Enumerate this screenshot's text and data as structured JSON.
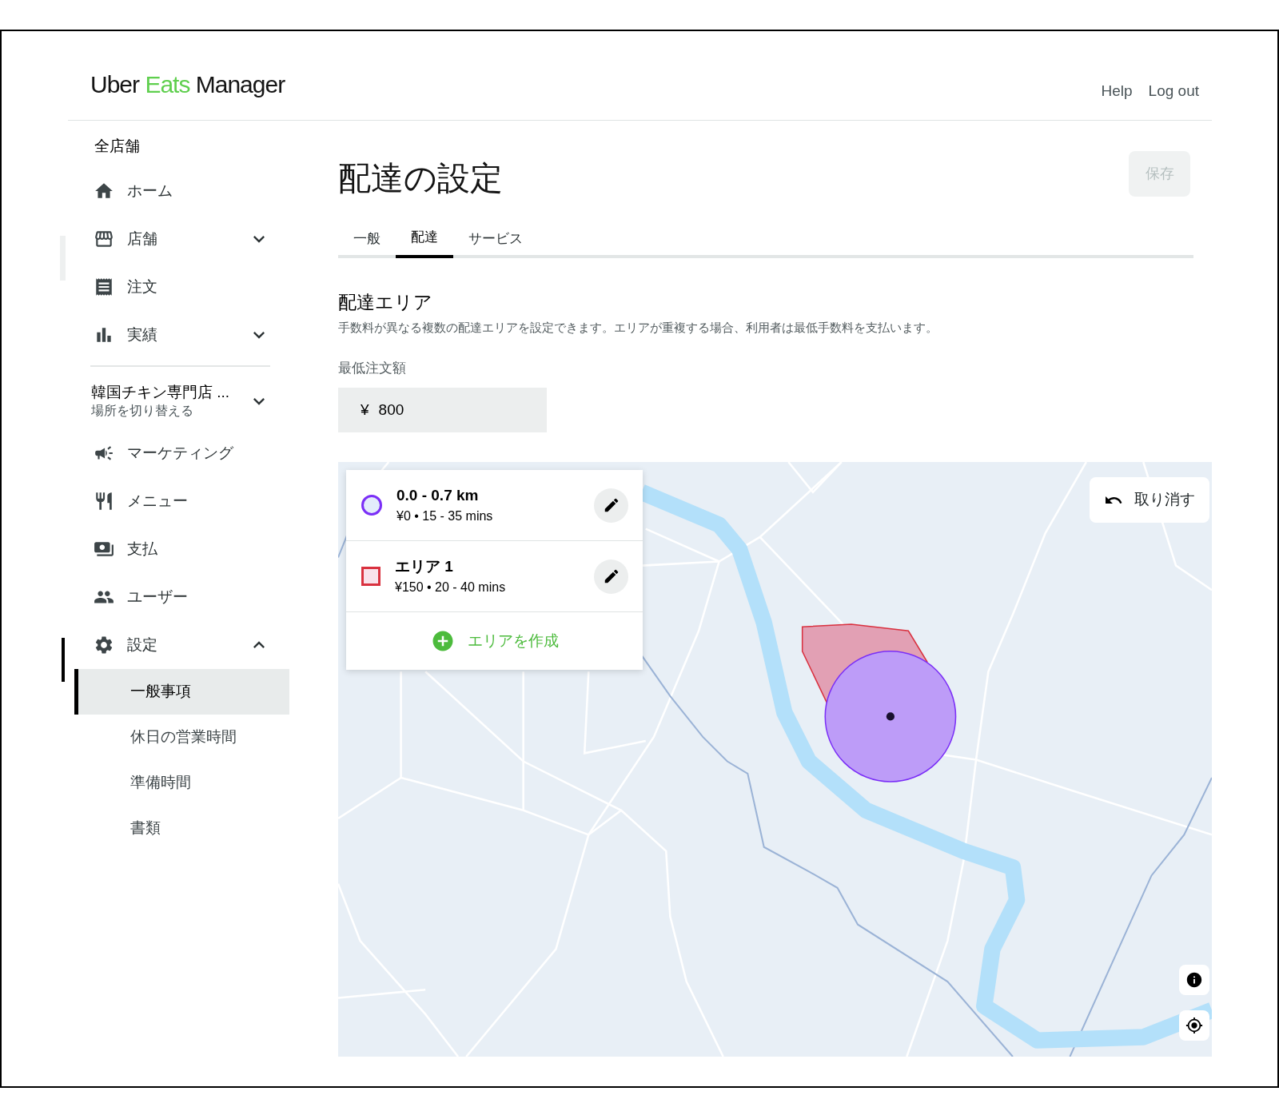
{
  "header": {
    "logo": {
      "brand": "Uber",
      "highlight": "Eats",
      "product": "Manager"
    },
    "links": [
      "Help",
      "Log out"
    ]
  },
  "sidebar": {
    "scope": "全店舗",
    "main_nav": [
      {
        "kind": "link",
        "label": "ホーム"
      },
      {
        "kind": "group",
        "label": "店舗",
        "expanded": false
      },
      {
        "kind": "link",
        "label": "注文"
      },
      {
        "kind": "group",
        "label": "実績",
        "expanded": false
      }
    ],
    "location": {
      "name": "韓国チキン専門店 ...",
      "action": "場所を切り替える",
      "expanded": false
    },
    "store_nav": [
      {
        "kind": "link",
        "label": "マーケティング"
      },
      {
        "kind": "link",
        "label": "メニュー"
      },
      {
        "kind": "link",
        "label": "支払"
      },
      {
        "kind": "link",
        "label": "ユーザー"
      },
      {
        "kind": "group",
        "label": "設定",
        "expanded": true,
        "children": [
          {
            "label": "一般事項",
            "selected": true
          },
          {
            "label": "休日の営業時間",
            "selected": false
          },
          {
            "label": "準備時間",
            "selected": false
          },
          {
            "label": "書類",
            "selected": false
          }
        ]
      }
    ]
  },
  "main": {
    "title": "配達の設定",
    "save_button": {
      "label": "保存",
      "disabled": true
    },
    "tabs": [
      {
        "label": "一般",
        "selected": false
      },
      {
        "label": "配達",
        "selected": true
      },
      {
        "label": "サービス",
        "selected": false
      }
    ],
    "section": {
      "title": "配達エリア",
      "description": "手数料が異なる複数の配達エリアを設定できます。エリアが重複する場合、利用者は最低手数料を支払います。"
    },
    "min_order": {
      "label": "最低注文額",
      "currency": "¥",
      "value": "800"
    },
    "map": {
      "undo_button": "取り消す",
      "areas": [
        {
          "kind": "circle",
          "color": "#7b2ff7",
          "title": "0.0 - 0.7 km",
          "detail": "¥0 • 15 - 35 mins"
        },
        {
          "kind": "polygon",
          "color": "#d9313f",
          "title": "エリア 1",
          "detail": "¥150 • 20 - 40 mins"
        }
      ],
      "create_button": "エリアを作成"
    }
  }
}
